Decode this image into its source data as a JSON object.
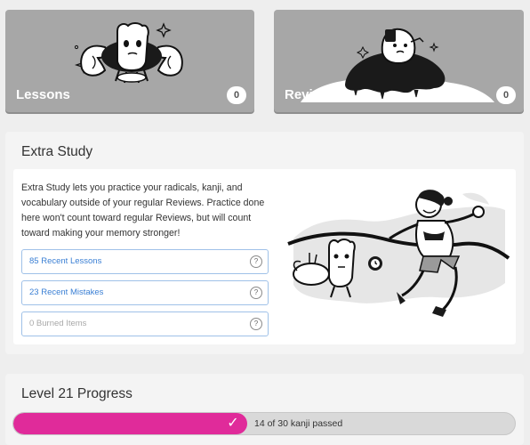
{
  "lessons": {
    "title": "Lessons",
    "count": "0"
  },
  "reviews": {
    "title": "Reviews",
    "count": "0"
  },
  "extra_study": {
    "title": "Extra Study",
    "description": "Extra Study lets you practice your radicals, kanji, and vocabulary outside of your regular Reviews. Practice done here won't count toward regular Reviews, but will count toward making your memory stronger!",
    "buttons": [
      {
        "label": "85 Recent Lessons",
        "help": "?"
      },
      {
        "label": "23 Recent Mistakes",
        "help": "?"
      },
      {
        "label": "0 Burned Items",
        "help": "?"
      }
    ]
  },
  "level_progress": {
    "title": "Level 21 Progress",
    "passed": 14,
    "total": 30,
    "status_text": "14 of 30 kanji passed",
    "accent": "#e02b9a"
  }
}
